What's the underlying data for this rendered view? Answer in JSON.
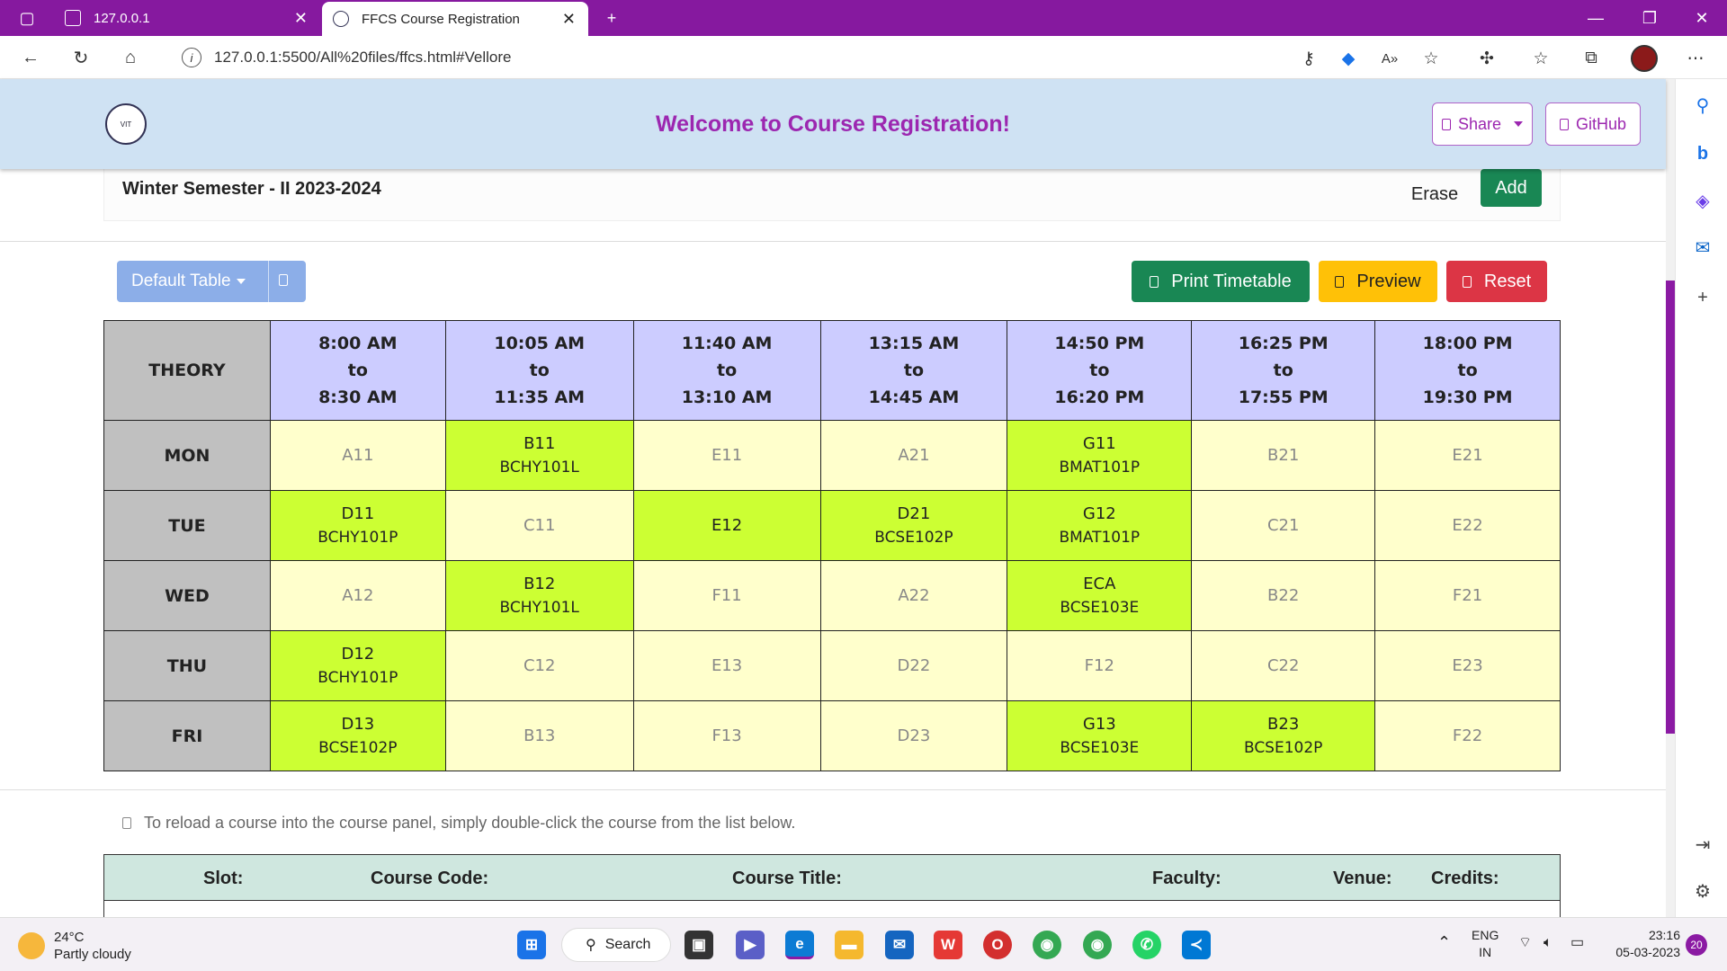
{
  "browser": {
    "tabs": [
      {
        "label": "127.0.0.1"
      },
      {
        "label": "FFCS Course Registration"
      }
    ],
    "url": "127.0.0.1:5500/All%20files/ffcs.html#Vellore"
  },
  "header": {
    "logo_text": "VIT",
    "title": "Welcome to Course Registration!",
    "share_label": "Share",
    "github_label": "GitHub"
  },
  "semester": {
    "title": "Winter Semester - II 2023-2024",
    "erase_label": "Erase",
    "add_label": "Add"
  },
  "actions": {
    "table_select": "Default Table",
    "print_label": "Print Timetable",
    "preview_label": "Preview",
    "reset_label": "Reset"
  },
  "timetable": {
    "corner": "THEORY",
    "times": [
      {
        "start": "8:00 AM",
        "sep": "to",
        "end": "8:30 AM"
      },
      {
        "start": "10:05 AM",
        "sep": "to",
        "end": "11:35 AM"
      },
      {
        "start": "11:40 AM",
        "sep": "to",
        "end": "13:10 AM"
      },
      {
        "start": "13:15 AM",
        "sep": "to",
        "end": "14:45 AM"
      },
      {
        "start": "14:50 PM",
        "sep": "to",
        "end": "16:20 PM"
      },
      {
        "start": "16:25 PM",
        "sep": "to",
        "end": "17:55 PM"
      },
      {
        "start": "18:00 PM",
        "sep": "to",
        "end": "19:30 PM"
      }
    ],
    "rows": [
      {
        "day": "MON",
        "cells": [
          {
            "slot": "A11",
            "code": "",
            "filled": false
          },
          {
            "slot": "B11",
            "code": "BCHY101L",
            "filled": true
          },
          {
            "slot": "E11",
            "code": "",
            "filled": false
          },
          {
            "slot": "A21",
            "code": "",
            "filled": false
          },
          {
            "slot": "G11",
            "code": "BMAT101P",
            "filled": true
          },
          {
            "slot": "B21",
            "code": "",
            "filled": false
          },
          {
            "slot": "E21",
            "code": "",
            "filled": false
          }
        ]
      },
      {
        "day": "TUE",
        "cells": [
          {
            "slot": "D11",
            "code": "BCHY101P",
            "filled": true
          },
          {
            "slot": "C11",
            "code": "",
            "filled": false
          },
          {
            "slot": "E12",
            "code": "",
            "filled": true
          },
          {
            "slot": "D21",
            "code": "BCSE102P",
            "filled": true
          },
          {
            "slot": "G12",
            "code": "BMAT101P",
            "filled": true
          },
          {
            "slot": "C21",
            "code": "",
            "filled": false
          },
          {
            "slot": "E22",
            "code": "",
            "filled": false
          }
        ]
      },
      {
        "day": "WED",
        "cells": [
          {
            "slot": "A12",
            "code": "",
            "filled": false
          },
          {
            "slot": "B12",
            "code": "BCHY101L",
            "filled": true
          },
          {
            "slot": "F11",
            "code": "",
            "filled": false
          },
          {
            "slot": "A22",
            "code": "",
            "filled": false
          },
          {
            "slot": "ECA",
            "code": "BCSE103E",
            "filled": true
          },
          {
            "slot": "B22",
            "code": "",
            "filled": false
          },
          {
            "slot": "F21",
            "code": "",
            "filled": false
          }
        ]
      },
      {
        "day": "THU",
        "cells": [
          {
            "slot": "D12",
            "code": "BCHY101P",
            "filled": true
          },
          {
            "slot": "C12",
            "code": "",
            "filled": false
          },
          {
            "slot": "E13",
            "code": "",
            "filled": false
          },
          {
            "slot": "D22",
            "code": "",
            "filled": false
          },
          {
            "slot": "F12",
            "code": "",
            "filled": false
          },
          {
            "slot": "C22",
            "code": "",
            "filled": false
          },
          {
            "slot": "E23",
            "code": "",
            "filled": false
          }
        ]
      },
      {
        "day": "FRI",
        "cells": [
          {
            "slot": "D13",
            "code": "BCSE102P",
            "filled": true
          },
          {
            "slot": "B13",
            "code": "",
            "filled": false
          },
          {
            "slot": "F13",
            "code": "",
            "filled": false
          },
          {
            "slot": "D23",
            "code": "",
            "filled": false
          },
          {
            "slot": "G13",
            "code": "BCSE103E",
            "filled": true
          },
          {
            "slot": "B23",
            "code": "BCSE102P",
            "filled": true
          },
          {
            "slot": "F22",
            "code": "",
            "filled": false
          }
        ]
      }
    ]
  },
  "course_list": {
    "hint": "To reload a course into the course panel, simply double-click the course from the list below.",
    "columns": [
      "Slot:",
      "Course Code:",
      "Course Title:",
      "Faculty:",
      "Venue:",
      "Credits:"
    ]
  },
  "taskbar": {
    "temp": "24°C",
    "weather": "Partly cloudy",
    "search": "Search",
    "lang1": "ENG",
    "lang2": "IN",
    "time": "23:16",
    "date": "05-03-2023",
    "notif_count": "20"
  },
  "colors": {
    "brand": "#86199f",
    "heading": "#9c27b0",
    "filled_slot": "#ccff33",
    "empty_slot": "#ffffcc",
    "time_header": "#ccccff"
  }
}
